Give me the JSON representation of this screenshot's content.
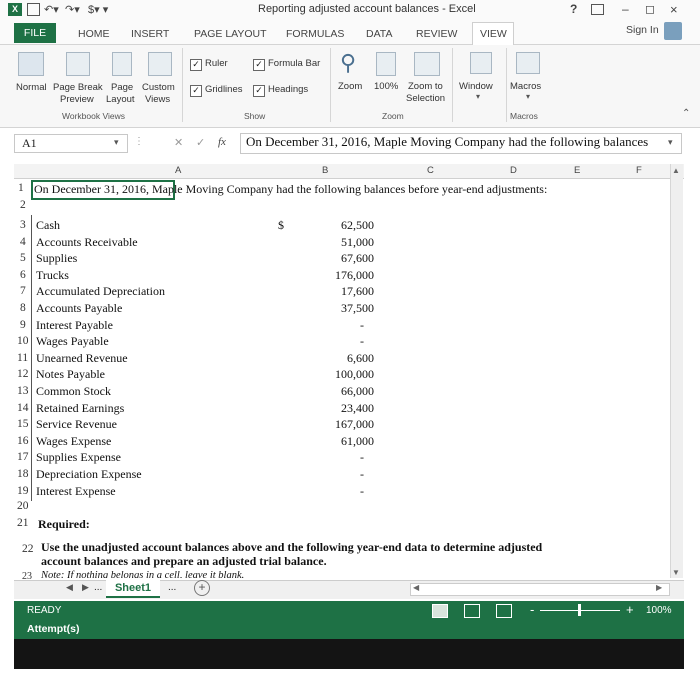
{
  "window": {
    "title": "Reporting adjusted account balances - Excel",
    "help": "?",
    "controls": [
      "–",
      "◻",
      "×"
    ]
  },
  "tabs": {
    "file": "FILE",
    "items": [
      "HOME",
      "INSERT",
      "PAGE LAYOUT",
      "FORMULAS",
      "DATA",
      "REVIEW",
      "VIEW"
    ],
    "sign_in": "Sign In"
  },
  "ribbon": {
    "workbook_views": {
      "normal": "Normal",
      "page_break": "Page Break",
      "page_break2": "Preview",
      "page_layout": "Page",
      "page_layout2": "Layout",
      "custom": "Custom",
      "custom2": "Views",
      "group": "Workbook Views"
    },
    "show": {
      "ruler": "Ruler",
      "formula_bar": "Formula Bar",
      "gridlines": "Gridlines",
      "headings": "Headings",
      "group": "Show"
    },
    "zoom": {
      "zoom": "Zoom",
      "hundred": "100%",
      "zoom_to": "Zoom to",
      "selection": "Selection",
      "group": "Zoom"
    },
    "window": {
      "label": "Window"
    },
    "macros": {
      "label": "Macros",
      "group": "Macros"
    }
  },
  "formula_bar": {
    "name_box": "A1",
    "cancel": "✕",
    "enter": "✓",
    "fx": "fx",
    "content": "On December 31, 2016, Maple Moving Company had the following balances"
  },
  "columns": [
    "A",
    "B",
    "C",
    "D",
    "E",
    "F"
  ],
  "sheet": {
    "row1": "On December 31, 2016, Maple Moving Company had the following balances before year-end adjustments:",
    "currency": "$",
    "accounts": [
      {
        "row": "3",
        "name": "Cash",
        "value": "62,500"
      },
      {
        "row": "4",
        "name": "Accounts Receivable",
        "value": "51,000"
      },
      {
        "row": "5",
        "name": "Supplies",
        "value": "67,600"
      },
      {
        "row": "6",
        "name": "Trucks",
        "value": "176,000"
      },
      {
        "row": "7",
        "name": "Accumulated Depreciation",
        "value": "17,600"
      },
      {
        "row": "8",
        "name": "Accounts Payable",
        "value": "37,500"
      },
      {
        "row": "9",
        "name": "Interest Payable",
        "value": "-"
      },
      {
        "row": "10",
        "name": "Wages Payable",
        "value": "-"
      },
      {
        "row": "11",
        "name": "Unearned Revenue",
        "value": "6,600"
      },
      {
        "row": "12",
        "name": "Notes Payable",
        "value": "100,000"
      },
      {
        "row": "13",
        "name": "Common Stock",
        "value": "66,000"
      },
      {
        "row": "14",
        "name": "Retained Earnings",
        "value": "23,400"
      },
      {
        "row": "15",
        "name": "Service Revenue",
        "value": "167,000"
      },
      {
        "row": "16",
        "name": "Wages Expense",
        "value": "61,000"
      },
      {
        "row": "17",
        "name": "Supplies Expense",
        "value": "-"
      },
      {
        "row": "18",
        "name": "Depreciation Expense",
        "value": "-"
      },
      {
        "row": "19",
        "name": "Interest Expense",
        "value": "-"
      }
    ],
    "required": "Required:",
    "instruction1": "Use the unadjusted account balances above and the following year-end data to determine adjusted",
    "instruction2": "account balances and prepare an adjusted trial balance.",
    "note": "Note: If nothing belongs in a cell, leave it blank."
  },
  "sheet_tabs": {
    "ellipsis_left": "...",
    "active": "Sheet1",
    "ellipsis_right": "...",
    "add": "+"
  },
  "status": {
    "ready": "READY",
    "zoom": "100%",
    "attempts": "Attempt(s)"
  }
}
